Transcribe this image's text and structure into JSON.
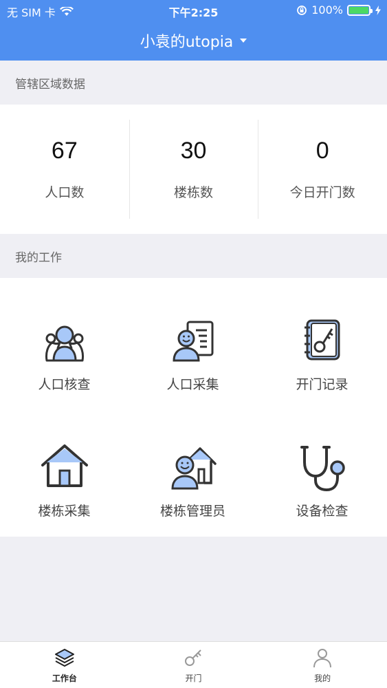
{
  "status_bar": {
    "carrier": "无 SIM 卡",
    "time": "下午2:25",
    "battery": "100%",
    "battery_level": 1.0
  },
  "nav": {
    "title": "小袁的utopia"
  },
  "region_section": {
    "title": "管辖区域数据",
    "stats": [
      {
        "value": "67",
        "label": "人口数"
      },
      {
        "value": "30",
        "label": "楼栋数"
      },
      {
        "value": "0",
        "label": "今日开门数"
      }
    ]
  },
  "work_section": {
    "title": "我的工作",
    "items": [
      {
        "label": "人口核查",
        "icon": "population-check-icon"
      },
      {
        "label": "人口采集",
        "icon": "population-collect-icon"
      },
      {
        "label": "开门记录",
        "icon": "door-record-icon"
      },
      {
        "label": "楼栋采集",
        "icon": "building-collect-icon"
      },
      {
        "label": "楼栋管理员",
        "icon": "building-admin-icon"
      },
      {
        "label": "设备检查",
        "icon": "device-check-icon"
      }
    ]
  },
  "tab_bar": {
    "tabs": [
      {
        "label": "工作台",
        "icon": "layers-icon",
        "active": true
      },
      {
        "label": "开门",
        "icon": "key-icon",
        "active": false
      },
      {
        "label": "我的",
        "icon": "user-icon",
        "active": false
      }
    ]
  },
  "colors": {
    "brand": "#4f8ff0",
    "icon_fill": "#a8c8f8",
    "icon_stroke": "#333333"
  }
}
